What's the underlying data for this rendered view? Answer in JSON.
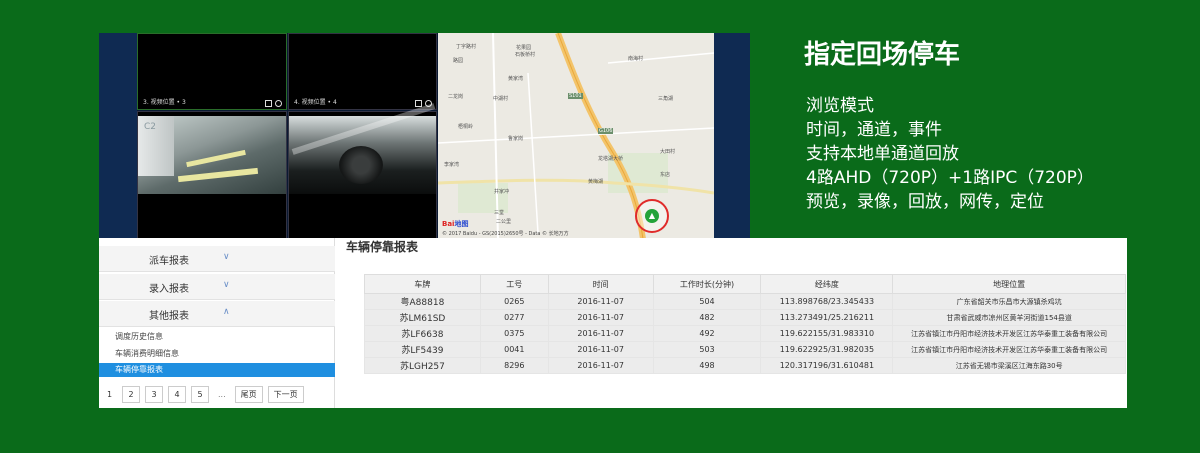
{
  "feature": {
    "title": "指定回场停车",
    "lines": [
      "浏览模式",
      "时间，通道，事件",
      "支持本地单通道回放",
      "4路AHD（720P）+1路IPC（720P）",
      "预览，录像，回放，网传，定位"
    ]
  },
  "viewer": {
    "cameras": [
      {
        "label": "3. 视频位置 • 3"
      },
      {
        "label": "4. 视频位置 • 4"
      }
    ],
    "garage_sign": "C2",
    "map": {
      "places": [
        "丁字路村",
        "花果园",
        "石板桥村",
        "路园",
        "黄家湾",
        "南海村",
        "二龙岗",
        "中湖村",
        "鲁家岗",
        "梧桐岭",
        "三角湖",
        "龙塔湖大桥",
        "黄梅湖",
        "大田村",
        "井家冲",
        "东店",
        "李家湾",
        "三堂",
        "二公里"
      ],
      "roads": [
        "G106",
        "S101"
      ],
      "logo": "Bai",
      "logo_suffix": "地图",
      "copyright": "© 2017 Baidu - GS(2015)2650号 - Data © 长地万方"
    }
  },
  "report": {
    "title": "车辆停靠报表",
    "sidebar": {
      "items": [
        {
          "label": "派车报表",
          "chevron": "∨"
        },
        {
          "label": "录入报表",
          "chevron": "∨"
        },
        {
          "label": "其他报表",
          "chevron": "∧"
        }
      ],
      "subitems": [
        "调度历史信息",
        "车辆消费明细信息",
        "车辆停靠报表"
      ]
    },
    "columns": [
      "车牌",
      "工号",
      "时间",
      "工作时长(分钟)",
      "经纬度",
      "地理位置"
    ],
    "rows": [
      [
        "粤A88818",
        "0265",
        "2016-11-07",
        "504",
        "113.898768/23.345433",
        "广东省韶关市乐昌市大源镇杀鸡坑"
      ],
      [
        "苏LM61SD",
        "0277",
        "2016-11-07",
        "482",
        "113.273491/25.216211",
        "甘肃省武威市凉州区黄羊河街道154县道"
      ],
      [
        "苏LF6638",
        "0375",
        "2016-11-07",
        "492",
        "119.622155/31.983310",
        "江苏省镇江市丹阳市经济技术开发区江苏华泰重工装备有限公司"
      ],
      [
        "苏LF5439",
        "0041",
        "2016-11-07",
        "503",
        "119.622925/31.982035",
        "江苏省镇江市丹阳市经济技术开发区江苏华泰重工装备有限公司"
      ],
      [
        "苏LGH257",
        "8296",
        "2016-11-07",
        "498",
        "120.317196/31.610481",
        "江苏省无锡市梁溪区江海东路30号"
      ]
    ],
    "pager": {
      "current": "1",
      "pages": [
        "2",
        "3",
        "4",
        "5"
      ],
      "ellipsis": "...",
      "last": "尾页",
      "next": "下一页"
    }
  },
  "colors": {
    "background": "#0a6b1a",
    "active_menu": "#1f8fe0",
    "gps_ring": "#e02b2b",
    "gps_dot": "#24a33a"
  }
}
